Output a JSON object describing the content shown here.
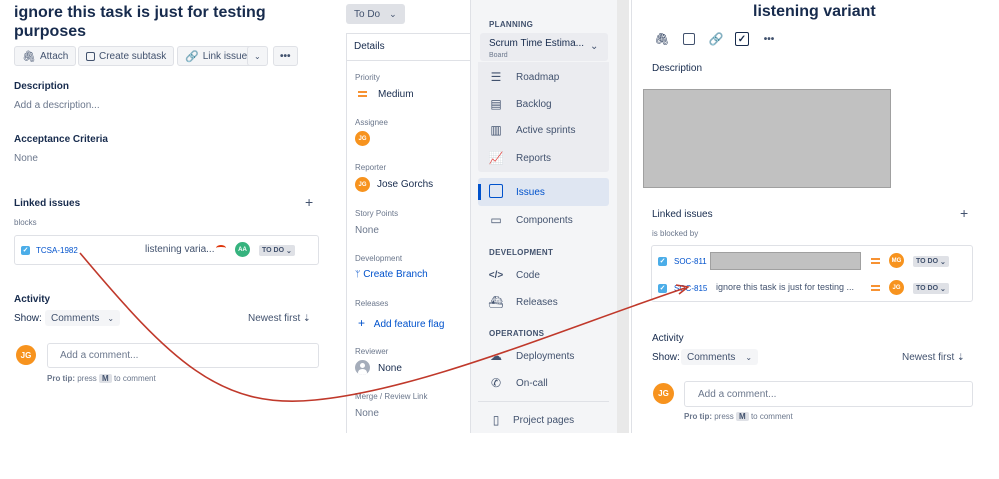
{
  "left": {
    "title_line1": "ignore this task is just for testing",
    "title_line2": "purposes",
    "toolbar": {
      "attach": "Attach",
      "create_subtask": "Create subtask",
      "link_issue": "Link issue",
      "more": "•••"
    },
    "description": {
      "heading": "Description",
      "placeholder": "Add a description..."
    },
    "acceptance": {
      "heading": "Acceptance Criteria",
      "value": "None"
    },
    "linked": {
      "heading": "Linked issues",
      "relation": "blocks",
      "item": {
        "key": "TCSA-1982",
        "summary": "listening varia...",
        "assignee_initials": "AA",
        "status": "TO DO"
      }
    },
    "activity": {
      "heading": "Activity",
      "show_label": "Show:",
      "filter": "Comments",
      "sort": "Newest first",
      "user_initials": "JG",
      "comment_placeholder": "Add a comment...",
      "tip_prefix": "Pro tip:",
      "tip_mid": "press",
      "tip_key": "M",
      "tip_suffix": "to comment"
    }
  },
  "details": {
    "status_button": "To Do",
    "heading": "Details",
    "priority_label": "Priority",
    "priority_value": "Medium",
    "assignee_label": "Assignee",
    "assignee_initials": "JG",
    "reporter_label": "Reporter",
    "reporter_initials": "JG",
    "reporter_name": "Jose Gorchs",
    "story_points_label": "Story Points",
    "story_points_value": "None",
    "development_label": "Development",
    "create_branch": "Create Branch",
    "releases_label": "Releases",
    "add_feature_flag": "Add feature flag",
    "reviewer_label": "Reviewer",
    "reviewer_value": "None",
    "merge_label": "Merge / Review Link",
    "merge_value": "None"
  },
  "sidebar": {
    "planning_heading": "PLANNING",
    "project_name": "Scrum Time Estima...",
    "project_type": "Board",
    "planning_items": [
      "Roadmap",
      "Backlog",
      "Active sprints",
      "Reports"
    ],
    "issues": "Issues",
    "components": "Components",
    "development_heading": "DEVELOPMENT",
    "development_items": [
      "Code",
      "Releases"
    ],
    "operations_heading": "OPERATIONS",
    "operations_items": [
      "Deployments",
      "On-call"
    ],
    "project_pages": "Project pages"
  },
  "right": {
    "title": "listening variant",
    "more": "•••",
    "description_heading": "Description",
    "linked": {
      "heading": "Linked issues",
      "relation": "is blocked by",
      "items": [
        {
          "key": "SOC-811",
          "summary": "",
          "assignee_initials": "MG",
          "status": "TO DO"
        },
        {
          "key": "SOC-815",
          "summary": "ignore this task is just for testing ...",
          "assignee_initials": "JG",
          "status": "TO DO"
        }
      ]
    },
    "activity": {
      "heading": "Activity",
      "show_label": "Show:",
      "filter": "Comments",
      "sort": "Newest first",
      "user_initials": "JG",
      "comment_placeholder": "Add a comment...",
      "tip_prefix": "Pro tip:",
      "tip_mid": "press",
      "tip_key": "M",
      "tip_suffix": "to comment"
    }
  },
  "colors": {
    "accent": "#0052cc",
    "annotation_arrow": "#c0392b",
    "avatar_orange": "#f7931e",
    "avatar_green": "#36b37e",
    "priority_medium": "#f79232",
    "redacted": "#c1c1c1"
  }
}
